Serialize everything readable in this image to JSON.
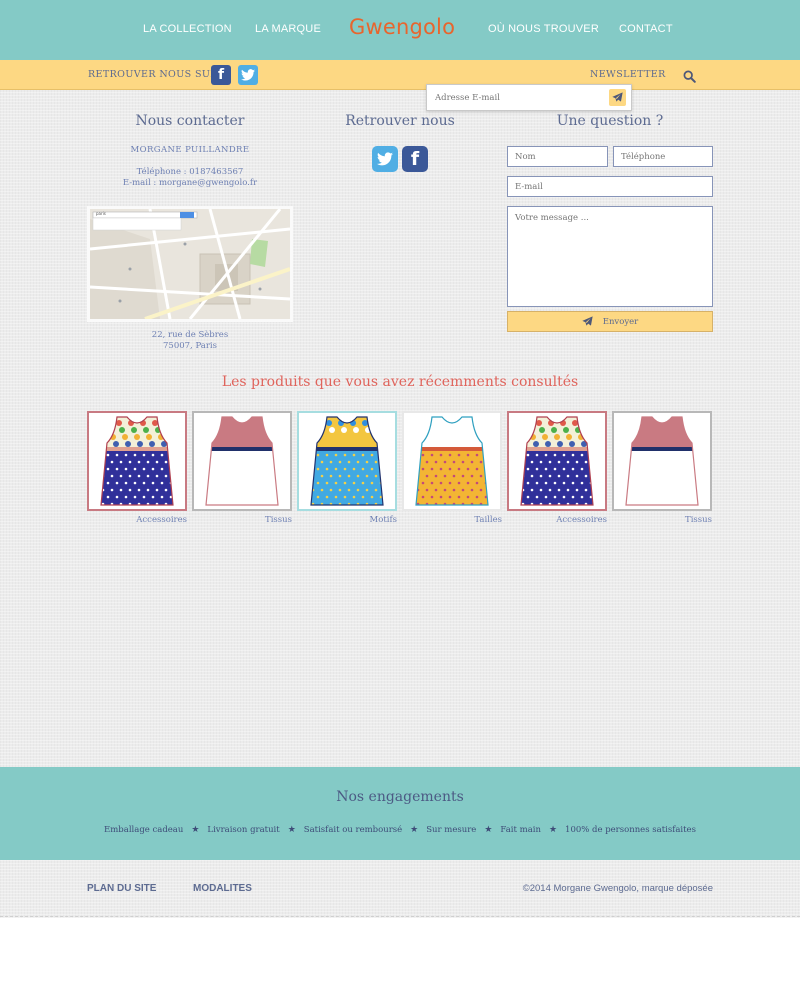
{
  "nav": {
    "collection": "LA COLLECTION",
    "brand": "LA MARQUE",
    "logo": "Gwengolo",
    "where": "OÙ NOUS TROUVER",
    "contact": "CONTACT"
  },
  "social_bar": {
    "label": "RETROUVER NOUS SUR",
    "facebook_glyph": "f",
    "newsletter": "NEWSLETTER",
    "email_placeholder": "Adresse E-mail"
  },
  "contact": {
    "title": "Nous contacter",
    "name": "MORGANE PUILLANDRE",
    "phone": "Téléphone : 0187463567",
    "email": "E-mail : morgane@gwengolo.fr",
    "address_line1": "22, rue de Sèbres",
    "address_line2": "75007, Paris",
    "map_search_text": "paris"
  },
  "follow": {
    "title": "Retrouver nous",
    "facebook_glyph": "f"
  },
  "question": {
    "title": "Une question ?",
    "name_placeholder": "Nom",
    "phone_placeholder": "Téléphone",
    "email_placeholder": "E-mail",
    "message_placeholder": "Votre message ...",
    "send_label": "Envoyer"
  },
  "recent": {
    "title": "Les produits que vous avez récemments consultés",
    "products": [
      {
        "label": "Accessoires",
        "pattern": "owls-navy",
        "border": "#c87a82"
      },
      {
        "label": "Tissus",
        "pattern": "white-red",
        "border": "#b8b8b8"
      },
      {
        "label": "Motifs",
        "pattern": "blue-floral",
        "border": "#a6dde0"
      },
      {
        "label": "Tailles",
        "pattern": "yellow-circles",
        "border": "#e8e8e8"
      },
      {
        "label": "Accessoires",
        "pattern": "owls-navy",
        "border": "#c87a82"
      },
      {
        "label": "Tissus",
        "pattern": "white-red",
        "border": "#b8b8b8"
      }
    ]
  },
  "engagements": {
    "title": "Nos engagements",
    "items": [
      "Emballage cadeau",
      "Livraison gratuit",
      "Satisfait ou remboursé",
      "Sur mesure",
      "Fait main",
      "100% de personnes satisfaites"
    ],
    "separator": "★"
  },
  "footer": {
    "sitemap": "PLAN DU SITE",
    "terms": "MODALITES",
    "copyright": "©2014 Morgane Gwengolo, marque déposée"
  },
  "colors": {
    "teal": "#84cac6",
    "yellow": "#fdd883",
    "logo_orange": "#e8652d",
    "accent_red": "#e0645c",
    "text_blue": "#6e80b3"
  }
}
